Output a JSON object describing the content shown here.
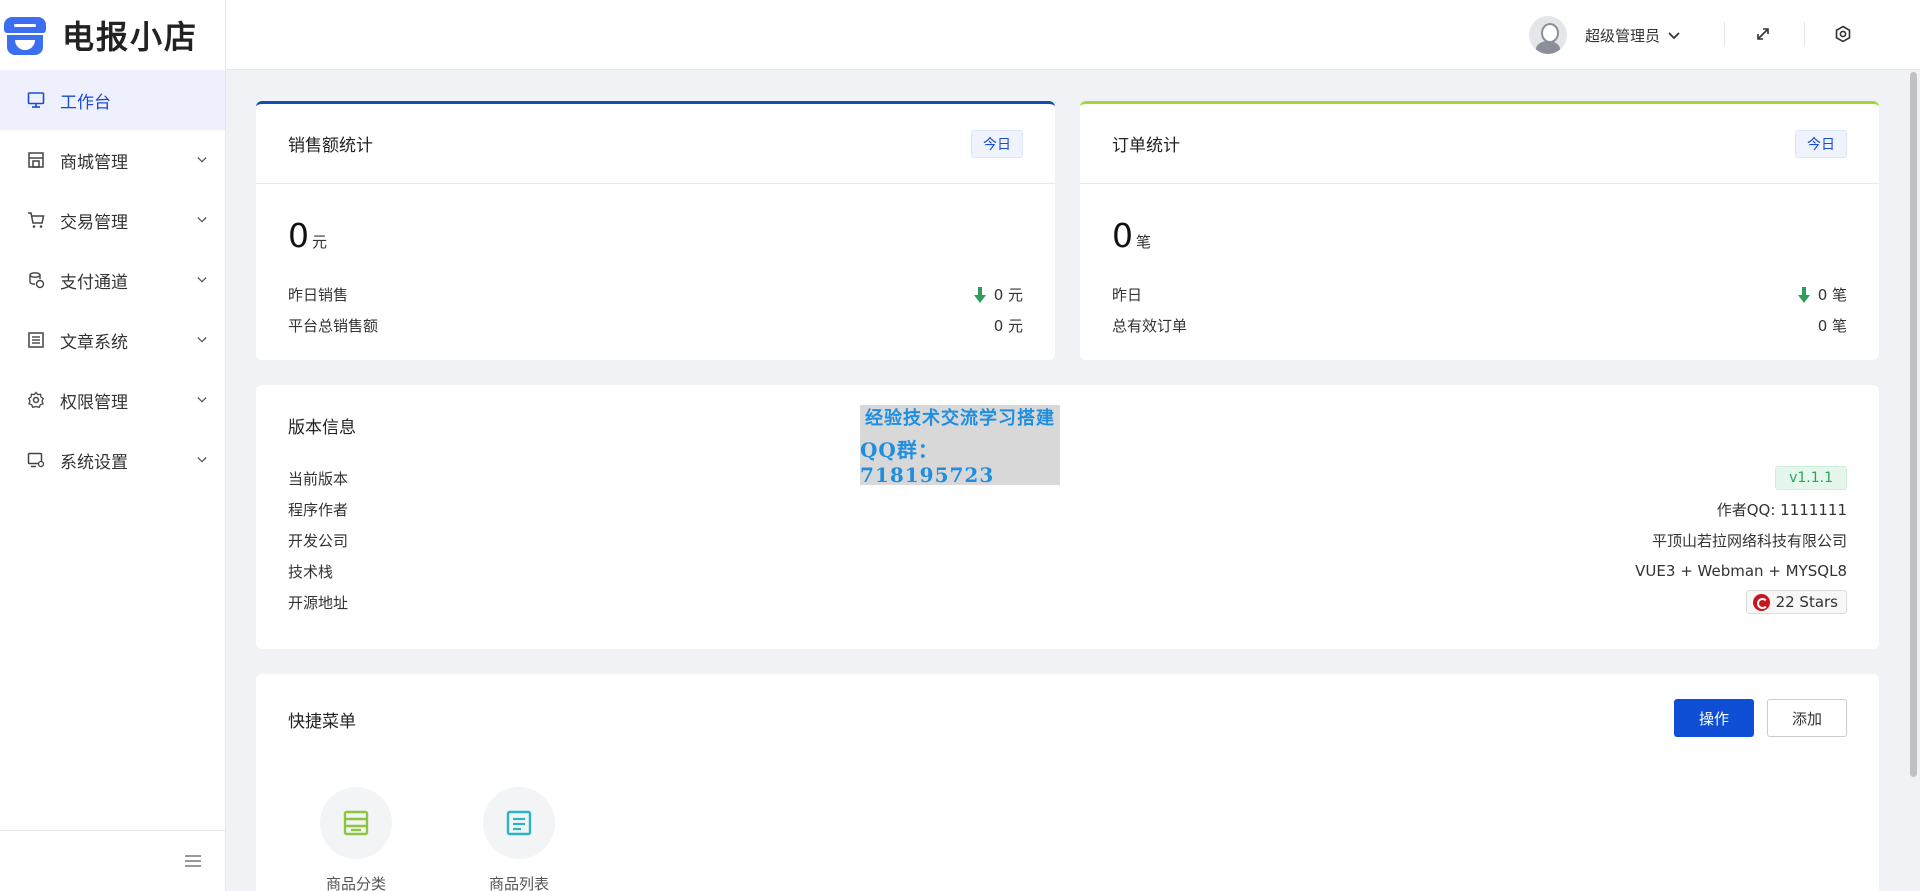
{
  "app": {
    "logo_text": "电报小店"
  },
  "sidebar": {
    "items": [
      {
        "label": "工作台",
        "icon": "monitor-icon",
        "active": true
      },
      {
        "label": "商城管理",
        "icon": "store-icon"
      },
      {
        "label": "交易管理",
        "icon": "cart-icon"
      },
      {
        "label": "支付通道",
        "icon": "coins-icon"
      },
      {
        "label": "文章系统",
        "icon": "article-icon"
      },
      {
        "label": "权限管理",
        "icon": "gear-icon"
      },
      {
        "label": "系统设置",
        "icon": "system-settings-icon"
      }
    ]
  },
  "header": {
    "user_name": "超级管理员"
  },
  "sales": {
    "title": "销售额统计",
    "tag": "今日",
    "value": "0",
    "unit": "元",
    "row1_label": "昨日销售",
    "row1_value": "0 元",
    "row2_label": "平台总销售额",
    "row2_value": "0 元",
    "accent": "#0f4fa8"
  },
  "orders": {
    "title": "订单统计",
    "tag": "今日",
    "value": "0",
    "unit": "笔",
    "row1_label": "昨日",
    "row1_value": "0 笔",
    "row2_label": "总有效订单",
    "row2_value": "0 笔",
    "accent": "#a5d637"
  },
  "version": {
    "title": "版本信息",
    "rows": [
      {
        "label": "当前版本",
        "value": "v1.1.1"
      },
      {
        "label": "程序作者",
        "value": "作者QQ: 1111111"
      },
      {
        "label": "开发公司",
        "value": "平顶山若拉网络科技有限公司"
      },
      {
        "label": "技术栈",
        "value": "VUE3 + Webman + MYSQL8"
      },
      {
        "label": "开源地址",
        "value": "22 Stars"
      }
    ]
  },
  "watermark": {
    "line1": "经验技术交流学习搭建",
    "line2": "QQ群：718195723"
  },
  "quick": {
    "title": "快捷菜单",
    "btn_operate": "操作",
    "btn_add": "添加",
    "items": [
      {
        "label": "商品分类",
        "icon": "category-icon",
        "color": "#8cc63f"
      },
      {
        "label": "商品列表",
        "icon": "list-icon",
        "color": "#2bb5c4"
      }
    ]
  }
}
